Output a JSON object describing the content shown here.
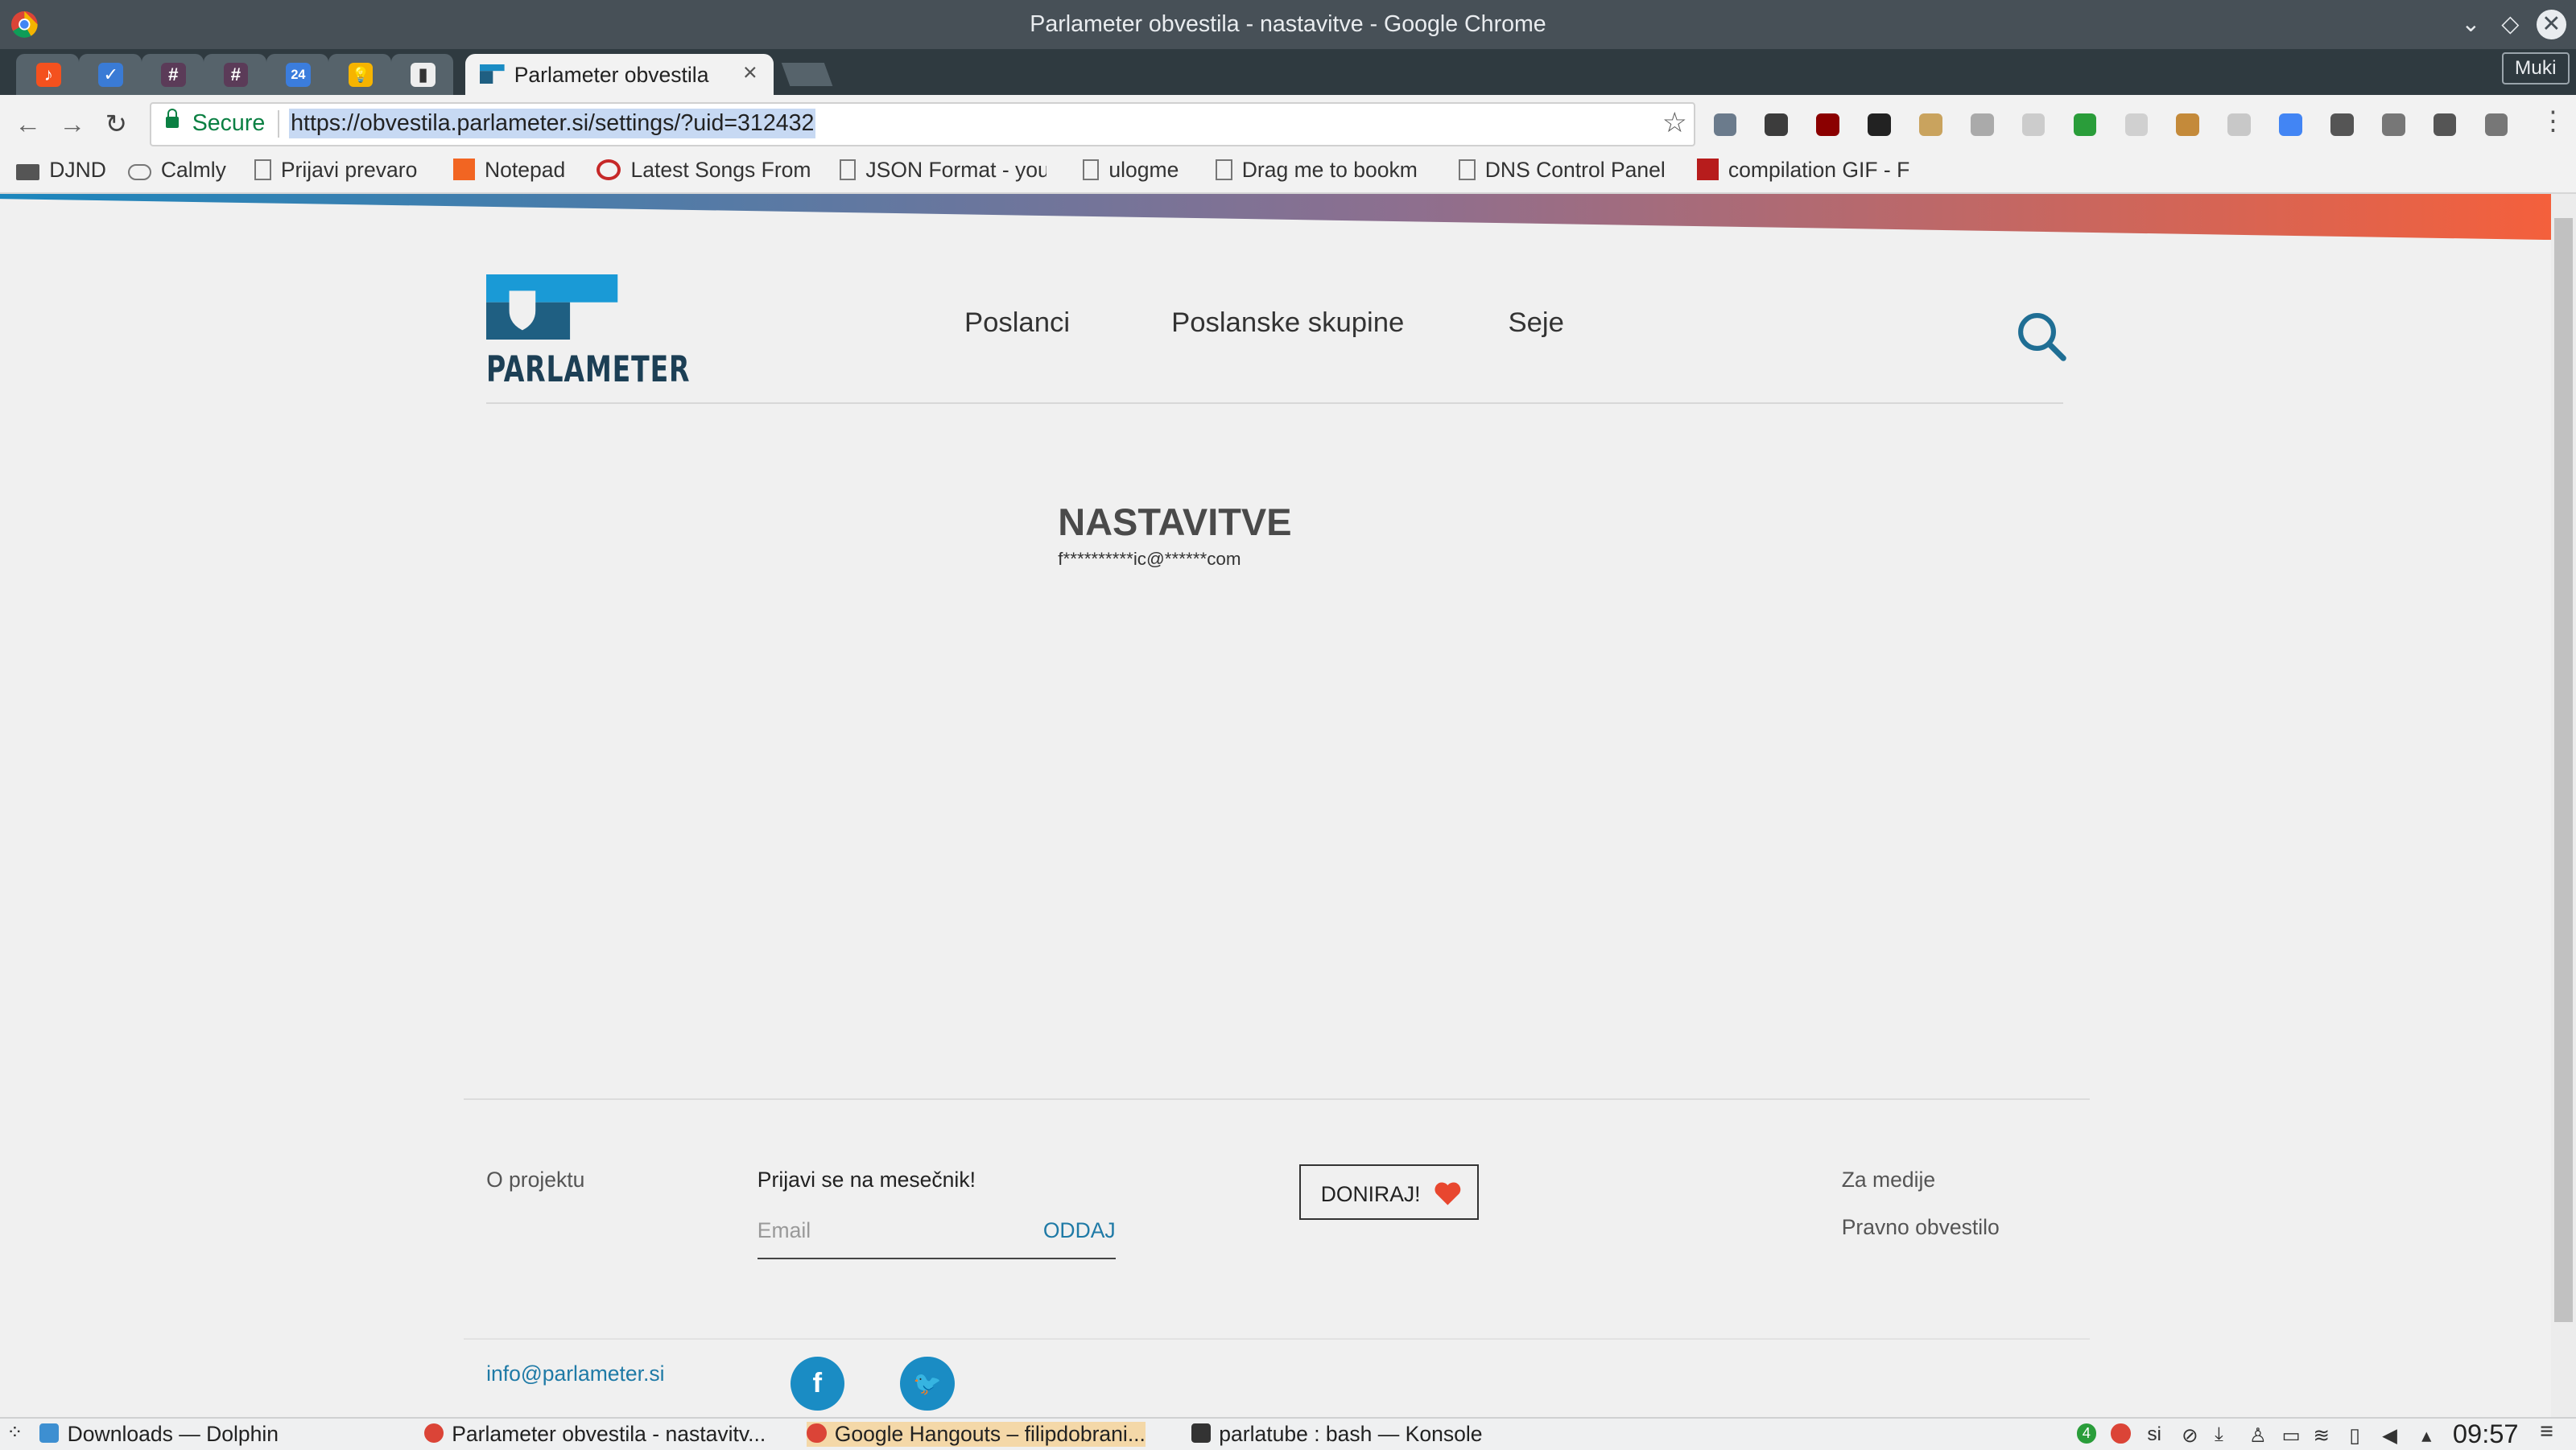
{
  "window": {
    "title": "Parlameter obvestila - nastavitve - Google Chrome",
    "profile": "Muki"
  },
  "tabs": {
    "active_label": "Parlameter obvestila",
    "mini": [
      {
        "icon": "music-icon",
        "color": "#f4511e",
        "glyph": "♪"
      },
      {
        "icon": "tasks-icon",
        "color": "#3a7bd5",
        "glyph": "✓"
      },
      {
        "icon": "slack-icon",
        "color": "#5b3b58",
        "glyph": "#"
      },
      {
        "icon": "slack-icon",
        "color": "#5b3b58",
        "glyph": "#"
      },
      {
        "icon": "calendar-icon",
        "color": "#3b7ddd",
        "glyph": "24"
      },
      {
        "icon": "keep-icon",
        "color": "#f6b400",
        "glyph": "💡"
      },
      {
        "icon": "reader-icon",
        "color": "#eeeeee",
        "glyph": "▮"
      }
    ]
  },
  "toolbar": {
    "secure_label": "Secure",
    "url": "https://obvestila.parlameter.si/settings/?uid=312432"
  },
  "bookmarks": [
    {
      "label": "DJND",
      "icon": "folder-icon"
    },
    {
      "label": "Calmly",
      "icon": "cloud-icon"
    },
    {
      "label": "Prijavi prevaro",
      "icon": "page-icon"
    },
    {
      "label": "Notepad",
      "icon": "notepad-icon"
    },
    {
      "label": "Latest Songs From",
      "icon": "eye-icon"
    },
    {
      "label": "JSON Format - you",
      "icon": "page-icon"
    },
    {
      "label": "ulogme",
      "icon": "page-icon"
    },
    {
      "label": "Drag me to bookm",
      "icon": "page-icon"
    },
    {
      "label": "DNS Control Panel",
      "icon": "page-icon"
    },
    {
      "label": "compilation GIF - F",
      "icon": "gif-icon"
    }
  ],
  "site": {
    "logo_text": "PARLAMETER",
    "nav": [
      "Poslanci",
      "Poslanske skupine",
      "Seje"
    ],
    "page_title": "NASTAVITVE",
    "masked_email": "f**********ic@******com"
  },
  "footer": {
    "o_projektu": "O projektu",
    "newsletter_title": "Prijavi se na mesečnik!",
    "email_placeholder": "Email",
    "submit_label": "ODDAJ",
    "donate_label": "DONIRAJ!",
    "za_medije": "Za medije",
    "pravno_obvestilo": "Pravno obvestilo",
    "contact_email": "info@parlameter.si",
    "facebook_glyph": "f",
    "twitter_glyph": "🐦"
  },
  "taskbar": {
    "tasks": [
      {
        "label": "Downloads — Dolphin",
        "icon": "dolphin-icon"
      },
      {
        "label": "Parlameter obvestila - nastavitv...",
        "icon": "chrome-icon"
      },
      {
        "label": "Google Hangouts – filipdobrani...",
        "icon": "chrome-icon"
      },
      {
        "label": "parlatube : bash — Konsole",
        "icon": "konsole-icon"
      }
    ],
    "keyboard_layout": "si",
    "clock": "09:57",
    "notification_count": "4"
  }
}
